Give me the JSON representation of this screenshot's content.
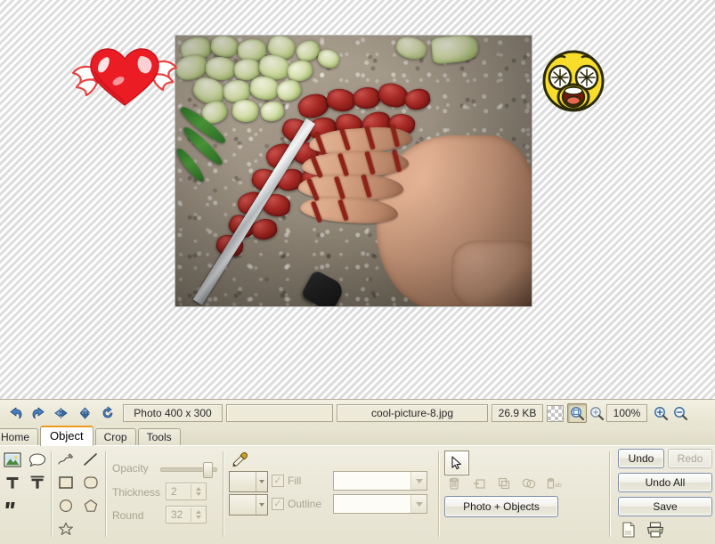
{
  "app": {
    "photo_caption": "Photo of chopped leeks and red sausage with a hand and knife on a granite countertop"
  },
  "statusbar": {
    "tools": [
      {
        "name": "undo-icon",
        "title": "Undo"
      },
      {
        "name": "redo-icon",
        "title": "Redo"
      },
      {
        "name": "flip-horizontal-icon",
        "title": "Flip Horizontal"
      },
      {
        "name": "flip-vertical-icon",
        "title": "Flip Vertical"
      },
      {
        "name": "rotate-icon",
        "title": "Rotate"
      }
    ],
    "dimensions": "Photo 400 x 300",
    "blank_field": "",
    "filename": "cool-picture-8.jpg",
    "filesize": "26.9 KB",
    "zoom_level": "100%",
    "zoom_tools": [
      {
        "name": "transparency-checker-icon",
        "title": "Transparency"
      },
      {
        "name": "fit-to-window-icon",
        "title": "Fit to window"
      },
      {
        "name": "zoom-to-fit-icon",
        "title": "Zoom to fit"
      },
      {
        "name": "zoom-in-icon",
        "title": "Zoom in"
      },
      {
        "name": "zoom-out-icon",
        "title": "Zoom out"
      }
    ]
  },
  "tabs": [
    {
      "id": "home",
      "label": "Home",
      "active": false
    },
    {
      "id": "object",
      "label": "Object",
      "active": true
    },
    {
      "id": "crop",
      "label": "Crop",
      "active": false
    },
    {
      "id": "tools",
      "label": "Tools",
      "active": false
    }
  ],
  "palette": {
    "items": [
      {
        "name": "sticker-image-icon",
        "label": "Image"
      },
      {
        "name": "speech-bubble-icon",
        "label": "Callout"
      },
      {
        "name": "text-icon",
        "label": "Text"
      },
      {
        "name": "text-outline-icon",
        "label": "Outlined Text"
      },
      {
        "name": "quote-icon",
        "label": "Quote"
      }
    ],
    "shapes": [
      {
        "name": "scribble-icon",
        "label": "Freehand"
      },
      {
        "name": "line-icon",
        "label": "Line"
      },
      {
        "name": "rectangle-icon",
        "label": "Rectangle"
      },
      {
        "name": "rounded-rectangle-icon",
        "label": "Rounded Rectangle"
      },
      {
        "name": "ellipse-icon",
        "label": "Ellipse"
      },
      {
        "name": "pentagon-icon",
        "label": "Pentagon"
      },
      {
        "name": "star-icon",
        "label": "Star"
      }
    ]
  },
  "properties": {
    "opacity_label": "Opacity",
    "opacity_value": "100",
    "thickness_label": "Thickness",
    "thickness_value": "2",
    "round_label": "Round",
    "round_value": "32",
    "eyedropper": "eyedropper-icon",
    "fill_label": "Fill",
    "fill_checked": true,
    "fill_style": "",
    "outline_label": "Outline",
    "outline_checked": true,
    "outline_style": ""
  },
  "objects": {
    "select_tool": "select-arrow-icon",
    "actions": [
      {
        "name": "delete-object-icon",
        "label": "Delete"
      },
      {
        "name": "duplicate-object-icon",
        "label": "Duplicate"
      },
      {
        "name": "bring-to-front-icon",
        "label": "Bring to Front"
      },
      {
        "name": "merge-objects-icon",
        "label": "Merge"
      },
      {
        "name": "rename-object-icon",
        "label": "Rename"
      }
    ],
    "mode_button": "Photo + Objects"
  },
  "actions": {
    "undo": "Undo",
    "redo": "Redo",
    "undo_all": "Undo All",
    "save": "Save",
    "new_icon": "new-document-icon",
    "print_icon": "print-icon"
  },
  "stickers": [
    {
      "name": "winged-heart-sticker",
      "label": "Winged heart"
    },
    {
      "name": "screaming-face-sticker",
      "label": "Screaming face emoji"
    }
  ],
  "colors": {
    "accent": "#f09a1e",
    "toolbar_bg": "#ece9d8",
    "panel_bg": "#ebe8d9",
    "canvas_bg": "#efefef",
    "button_border": "#7b8ca6",
    "disabled_text": "#a8a593"
  }
}
